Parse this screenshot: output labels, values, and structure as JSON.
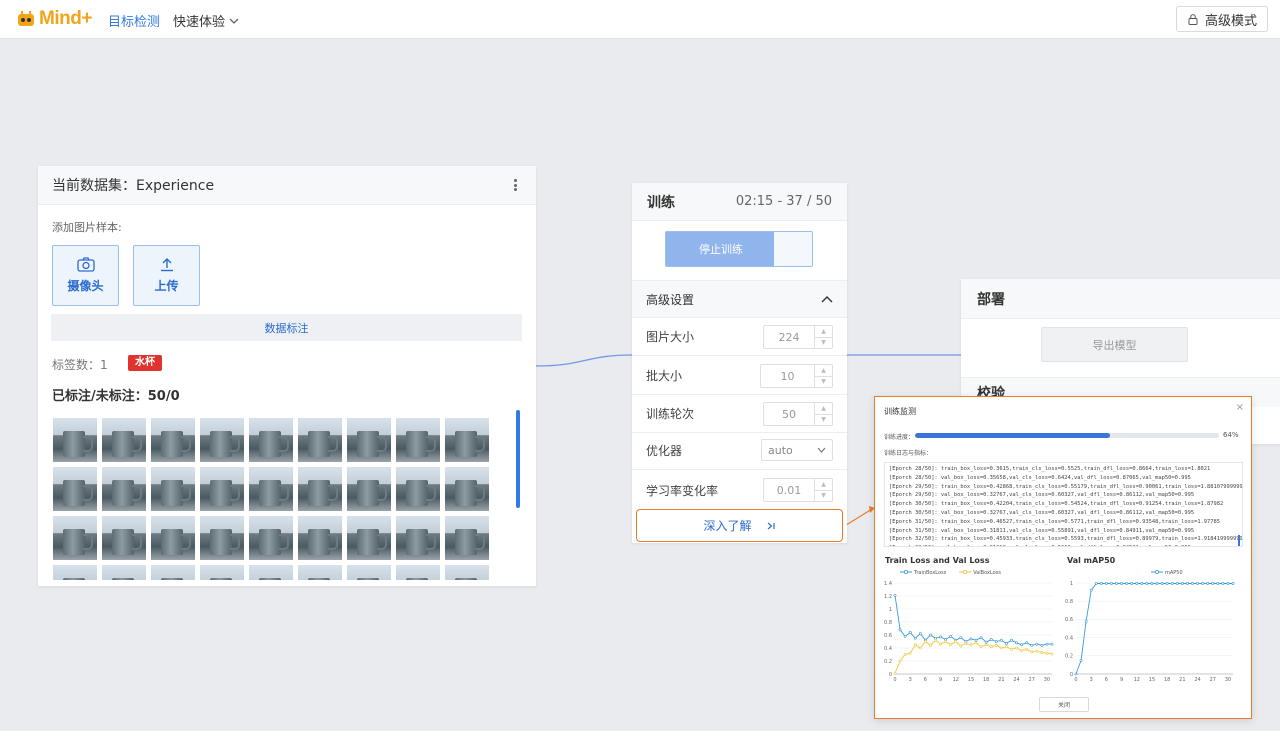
{
  "app": {
    "brand": "Mind+",
    "brand_color": "#f2a51a",
    "accent": "#3478e6",
    "highlight": "#e87b2d"
  },
  "topbar": {
    "nav_active": "目标检测",
    "nav_menu": "快速体验",
    "advanced_mode": "高级模式"
  },
  "dataset": {
    "title": "当前数据集：Experience",
    "add_samples": "添加图片样本:",
    "camera_label": "摄像头",
    "upload_label": "上传",
    "annotate_label": "数据标注",
    "tag_count_label": "标签数：",
    "tag_count": "1",
    "tag": "水杯",
    "tag_color": "#e0322f",
    "status": "已标注/未标注：50/0",
    "thumbnail_count": 36
  },
  "training": {
    "title": "训练",
    "elapsed": "02:15 - 37 / 50",
    "stop_label": "停止训练",
    "progress_fraction": 0.74,
    "advanced_label": "高级设置",
    "params": [
      {
        "label": "图片大小",
        "value": "224",
        "kind": "number"
      },
      {
        "label": "批大小",
        "value": "10",
        "kind": "number"
      },
      {
        "label": "训练轮次",
        "value": "50",
        "kind": "number"
      },
      {
        "label": "优化器",
        "value": "auto",
        "kind": "select"
      },
      {
        "label": "学习率变化率",
        "value": "0.01",
        "kind": "number"
      }
    ],
    "learn_more": "深入了解"
  },
  "deploy": {
    "title": "部署",
    "export_label": "导出模型",
    "verify_title": "校验"
  },
  "monitor": {
    "title": "训练监测",
    "progress_label": "训练进度：",
    "progress": 0.64,
    "progress_text": "64%",
    "log_label": "训练日志与指标：",
    "log": [
      "[Eporch 28/50]: train_box_loss=0.3615,train_cls_loss=0.5525,train_dfl_loss=0.8664,train_loss=1.8021",
      "[Eporch 28/50]: val_box_loss=0.35658,val_cls_loss=0.6424,val_dfl_loss=0.87065,val_map50=0.995",
      "[Eporch 29/50]: train_box_loss=0.42868,train_cls_loss=0.55179,train_dfl_loss=0.90061,train_loss=1.8810799999999999",
      "[Eporch 29/50]: val_box_loss=0.32767,val_cls_loss=0.60327,val_dfl_loss=0.86112,val_map50=0.995",
      "[Eporch 30/50]: train_box_loss=0.42204,train_cls_loss=0.54524,train_dfl_loss=0.91254,train_loss=1.87982",
      "[Eporch 30/50]: val_box_loss=0.32767,val_cls_loss=0.60327,val_dfl_loss=0.86112,val_map50=0.995",
      "[Eporch 31/50]: train_box_loss=0.46527,train_cls_loss=0.5771,train_dfl_loss=0.93548,train_loss=1.97785",
      "[Eporch 31/50]: val_box_loss=0.31811,val_cls_loss=0.55891,val_dfl_loss=0.84911,val_map50=0.995",
      "[Eporch 32/50]: train_box_loss=0.45933,train_cls_loss=0.5593,train_dfl_loss=0.89979,train_loss=1.9184199999999998",
      "[Eporch 32/50]: val_box_loss=0.31018,val_cls_loss=0.5663,val_dfl_loss=0.84581,val_map50=0.995"
    ],
    "close_label": "关闭"
  },
  "chart_data": [
    {
      "type": "line",
      "title": "Train Loss and Val Loss",
      "ylim": [
        0,
        1.4
      ],
      "xlim": [
        0,
        31
      ],
      "xticks": [
        "0",
        "3",
        "6",
        "9",
        "12",
        "15",
        "18",
        "21",
        "24",
        "27",
        "30"
      ],
      "yticks": [
        "0",
        "0.2",
        "0.4",
        "0.6",
        "0.8",
        "1",
        "1.2",
        "1.4"
      ],
      "legend_position": "top",
      "grid": true,
      "series": [
        {
          "name": "TrainBoxLoss",
          "color": "#3a9ad9",
          "values": [
            1.21,
            0.68,
            0.58,
            0.64,
            0.55,
            0.62,
            0.52,
            0.6,
            0.55,
            0.57,
            0.53,
            0.58,
            0.52,
            0.56,
            0.5,
            0.54,
            0.52,
            0.56,
            0.49,
            0.53,
            0.5,
            0.52,
            0.47,
            0.52,
            0.48,
            0.45,
            0.48,
            0.44,
            0.46,
            0.44,
            0.46,
            0.46
          ]
        },
        {
          "name": "ValBoxLoss",
          "color": "#f2c53a",
          "values": [
            0.01,
            0.2,
            0.3,
            0.32,
            0.45,
            0.4,
            0.5,
            0.44,
            0.52,
            0.46,
            0.5,
            0.45,
            0.5,
            0.43,
            0.47,
            0.45,
            0.48,
            0.42,
            0.45,
            0.42,
            0.44,
            0.4,
            0.42,
            0.38,
            0.4,
            0.36,
            0.38,
            0.34,
            0.35,
            0.33,
            0.32,
            0.31
          ]
        }
      ]
    },
    {
      "type": "line",
      "title": "Val mAP50",
      "ylim": [
        0,
        1
      ],
      "xlim": [
        0,
        31
      ],
      "xticks": [
        "0",
        "3",
        "6",
        "9",
        "12",
        "15",
        "18",
        "21",
        "24",
        "27",
        "30"
      ],
      "yticks": [
        "0",
        "0.2",
        "0.4",
        "0.6",
        "0.8",
        "1"
      ],
      "legend_position": "top",
      "grid": true,
      "series": [
        {
          "name": "mAP50",
          "color": "#3a9ad9",
          "values": [
            0,
            0.15,
            0.58,
            0.92,
            0.995,
            0.995,
            0.995,
            0.995,
            0.995,
            0.995,
            0.995,
            0.995,
            0.995,
            0.995,
            0.995,
            0.995,
            0.995,
            0.995,
            0.995,
            0.995,
            0.995,
            0.995,
            0.995,
            0.995,
            0.995,
            0.995,
            0.995,
            0.995,
            0.995,
            0.995,
            0.995,
            0.995
          ]
        }
      ]
    }
  ]
}
